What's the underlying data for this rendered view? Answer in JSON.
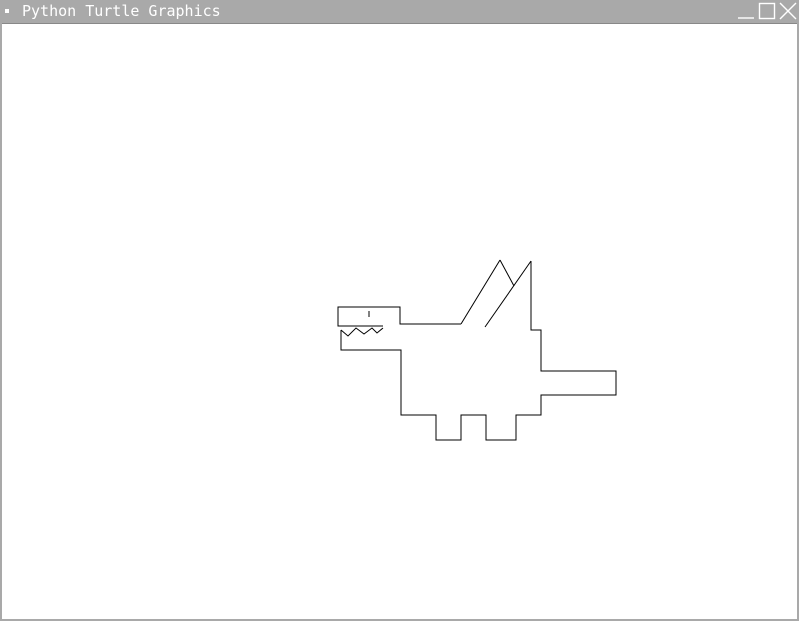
{
  "window": {
    "title": "Python Turtle Graphics",
    "controls": {
      "minimize_icon": "minimize-icon",
      "maximize_icon": "maximize-icon",
      "close_icon": "close-icon"
    }
  },
  "canvas": {
    "background": "#ffffff",
    "stroke_color": "#000000",
    "drawing": "dragon"
  },
  "colors": {
    "titlebar": "#a9a9a9",
    "title_text": "#ffffff"
  }
}
